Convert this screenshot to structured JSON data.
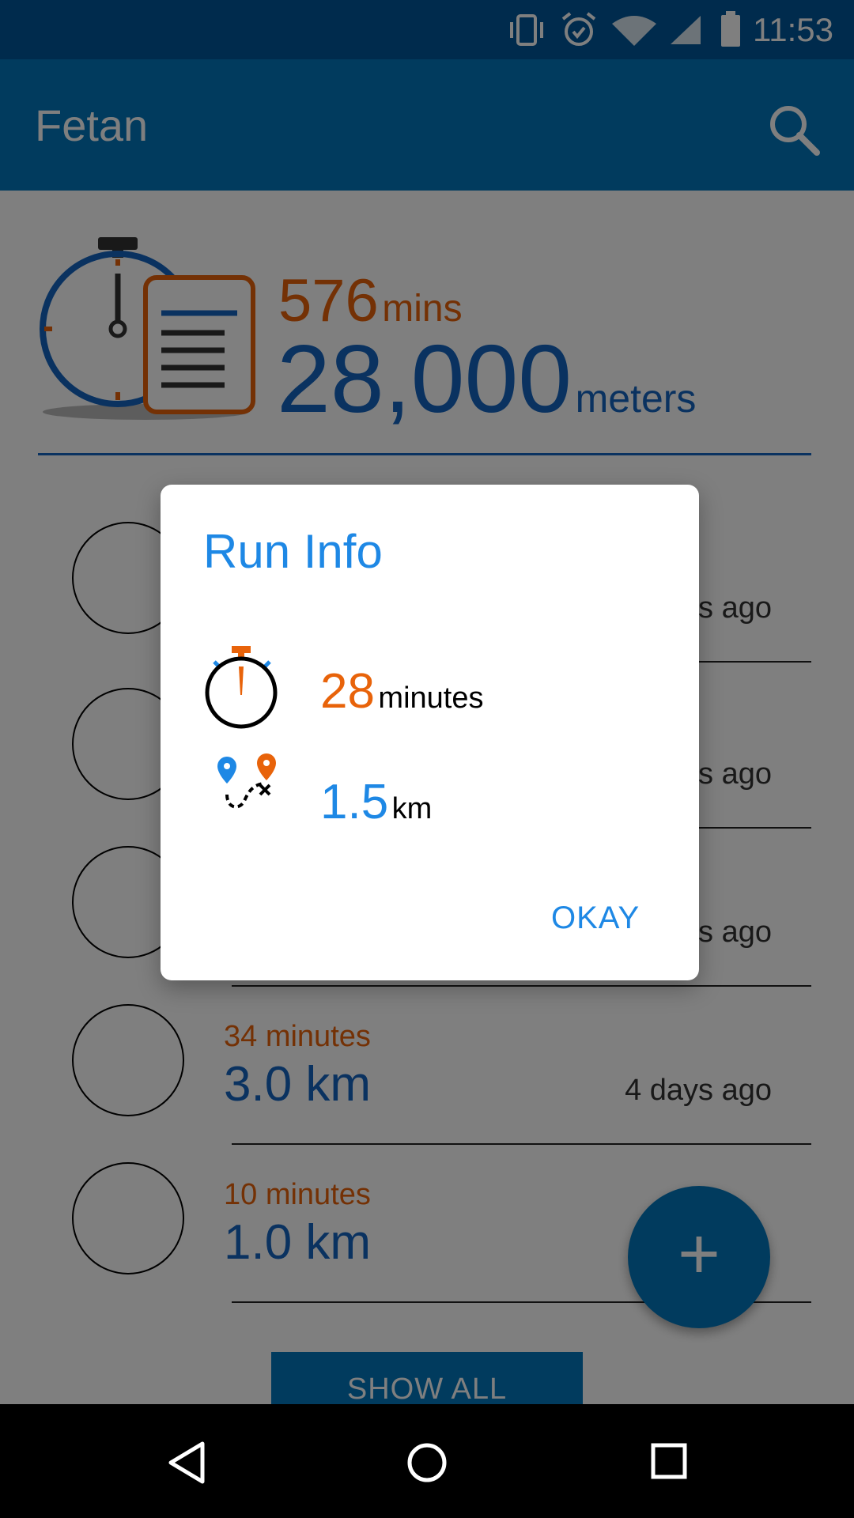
{
  "status_bar": {
    "time": "11:53",
    "icons": [
      "vibrate-icon",
      "alarm-icon",
      "wifi-icon",
      "signal-icon",
      "battery-icon"
    ]
  },
  "app_bar": {
    "title": "Fetan",
    "search_icon": "search-icon"
  },
  "summary": {
    "mins_value": "576",
    "mins_unit": "mins",
    "meters_value": "28,000",
    "meters_unit": "meters"
  },
  "runs": [
    {
      "minutes": "",
      "distance": "",
      "ago": "s ago"
    },
    {
      "minutes": "",
      "distance": "",
      "ago": "s ago"
    },
    {
      "minutes": "",
      "distance": "",
      "ago": "s ago"
    },
    {
      "minutes": "34 minutes",
      "distance": "3.0 km",
      "ago": "4 days ago"
    },
    {
      "minutes": "10 minutes",
      "distance": "1.0 km",
      "ago": ""
    }
  ],
  "show_all_label": "SHOW ALL",
  "fab_label": "+",
  "dialog": {
    "title": "Run Info",
    "time_value": "28",
    "time_unit": "minutes",
    "distance_value": "1.5",
    "distance_unit": "km",
    "ok_label": "OKAY"
  },
  "colors": {
    "primary_dark": "#01579b",
    "primary": "#0277bd",
    "orange": "#e8630a",
    "blue_text": "#1565c0",
    "dialog_blue": "#1e88e5"
  }
}
